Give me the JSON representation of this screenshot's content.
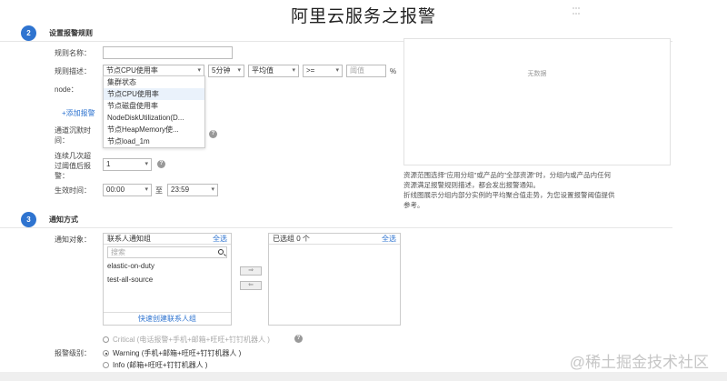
{
  "page_title": "阿里云服务之报警",
  "steps": [
    {
      "num": "2",
      "title": "设置报警规则"
    },
    {
      "num": "3",
      "title": "通知方式"
    }
  ],
  "rule": {
    "name_label": "规则名称：",
    "desc_label": "规则描述：",
    "metric_selected": "节点CPU使用率",
    "period": "5分钟",
    "stat": "平均值",
    "operator": ">=",
    "threshold_placeholder": "阈值",
    "unit": "%",
    "node_label": "node：",
    "metric_options": [
      "集群状态",
      "节点CPU使用率",
      "节点磁盘使用率",
      "NodeDiskUtilization(D...",
      "节点HeapMemory使...",
      "节点load_1m"
    ],
    "add_label": "+添加报警",
    "silence_label": "通道沉默时间：",
    "consecutive_label": "连续几次超过阈值后报警：",
    "consecutive_value": "1",
    "effective_label": "生效时间：",
    "time_start": "00:00",
    "time_to": "至",
    "time_end": "23:59"
  },
  "chart": {
    "no_data": "无数据",
    "note_lines": [
      "资源范围选择\"应用分组\"或产品的\"全部资源\"时，分组内或产品内任何",
      "资源满足报警规则描述，都会发出报警通知。",
      "折线图展示分组内部分实例的平均聚合值走势，为您设置报警阈值提供",
      "参考。"
    ]
  },
  "notify": {
    "target_label": "通知对象：",
    "left_panel_title": "联系人通知组",
    "select_all": "全选",
    "search_placeholder": "搜索",
    "contacts": [
      "elastic-on-duty",
      "test-all-source"
    ],
    "quick_create": "快速创建联系人组",
    "right_panel_title": "已选组 0 个",
    "move_right": "⇒",
    "move_left": "⇐",
    "level_label": "报警级别：",
    "levels": [
      {
        "label": "Critical (电话报警+手机+邮箱+旺旺+钉钉机器人 )",
        "checked": false,
        "disabled": true
      },
      {
        "label": "Warning (手机+邮箱+旺旺+钉钉机器人 )",
        "checked": true,
        "disabled": false
      },
      {
        "label": "Info (邮箱+旺旺+钉钉机器人 )",
        "checked": false,
        "disabled": false
      }
    ]
  },
  "watermark": "@稀土掘金技术社区",
  "colors": {
    "accent": "#2f74d0"
  }
}
